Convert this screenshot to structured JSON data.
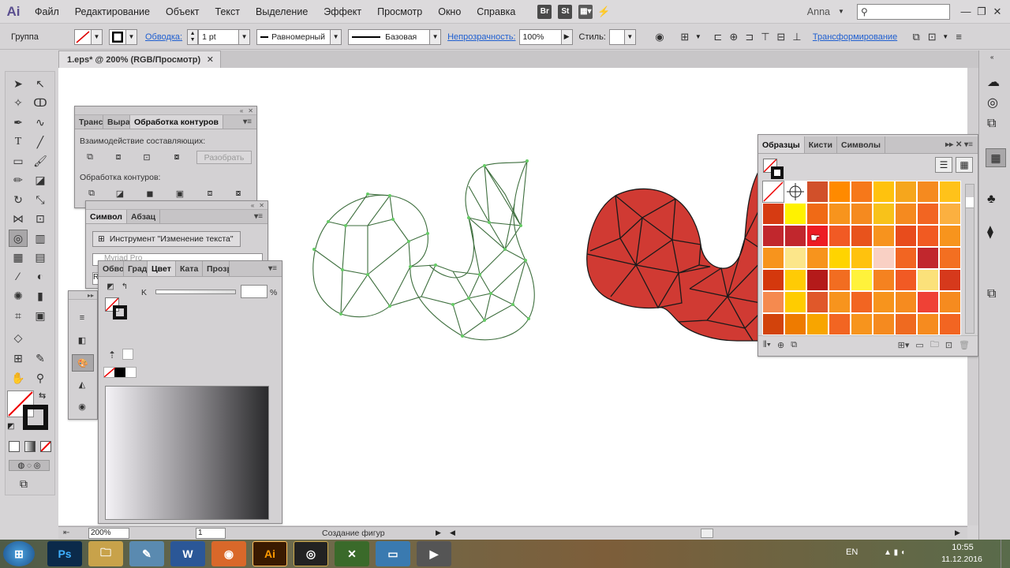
{
  "menubar": {
    "logo": "Ai",
    "items": [
      "Файл",
      "Редактирование",
      "Объект",
      "Текст",
      "Выделение",
      "Эффект",
      "Просмотр",
      "Окно",
      "Справка"
    ],
    "bridge": "Br",
    "stock": "St",
    "user": "Anna",
    "search_placeholder": ""
  },
  "control_bar": {
    "selection": "Группа",
    "stroke_label": "Обводка:",
    "stroke_weight": "1 pt",
    "profile": "Равномерный",
    "brush": "Базовая",
    "opacity_label": "Непрозрачность:",
    "opacity": "100%",
    "style_label": "Стиль:",
    "transform_link": "Трансформирование"
  },
  "document": {
    "tab": "1.eps* @ 200% (RGB/Просмотр)",
    "zoom": "200%",
    "page": "1",
    "status": "Создание фигур"
  },
  "pathfinder_panel": {
    "tabs": [
      "Трансф",
      "Выра",
      "Обработка контуров"
    ],
    "shape_modes_label": "Взаимодействие составляющих:",
    "expand_button": "Разобрать",
    "pathfinders_label": "Обработка контуров:"
  },
  "character_panel": {
    "tabs": [
      "Символ",
      "Абзац"
    ],
    "touch_type_button": "Инструмент \"Изменение текста\"",
    "font": "Myriad Pro"
  },
  "color_panel": {
    "tabs": [
      "Обвод",
      "Град",
      "Цвет",
      "Ката",
      "Прозр"
    ],
    "channel": "K",
    "channel_value": "",
    "unit": "%"
  },
  "swatches_panel": {
    "tabs": [
      "Образцы",
      "Кисти",
      "Символы"
    ],
    "colors": [
      "#ffffff",
      "#ffffff",
      "#d1502a",
      "#ff8a00",
      "#f6781a",
      "#ffc20e",
      "#f6a61c",
      "#f58a1f",
      "#ffc21a",
      "#d63b12",
      "#fff200",
      "#f06a16",
      "#f7941d",
      "#f58a1f",
      "#f8c21a",
      "#f58a1f",
      "#f26522",
      "#fbb040",
      "#c1272d",
      "#c1272d",
      "#ed1c24",
      "#f15a24",
      "#e8531c",
      "#f7931e",
      "#e84c1c",
      "#f15a22",
      "#f7941d",
      "#f7941d",
      "#fce68a",
      "#f7941d",
      "#ffd400",
      "#ffc20e",
      "#f9d0c4",
      "#f26522",
      "#c1272d",
      "#f36f21",
      "#d4380d",
      "#ffcb05",
      "#b41a1a",
      "#f26d21",
      "#fff23b",
      "#f58220",
      "#f15a24",
      "#fbe17a",
      "#d6391c",
      "#f58a4f",
      "#ffcc00",
      "#e0582a",
      "#f7941d",
      "#f26522",
      "#f7941d",
      "#f68b1f",
      "#ef4136",
      "#f68b1f",
      "#d2430c",
      "#ee7b00",
      "#f8a500",
      "#f26522",
      "#f7941d",
      "#f58a1f",
      "#ef6a20",
      "#f68b1f",
      "#f26522"
    ]
  },
  "taskbar": {
    "lang": "EN",
    "time": "10:55",
    "date": "11.12.2016",
    "apps": [
      "Ps",
      "Ai"
    ]
  }
}
